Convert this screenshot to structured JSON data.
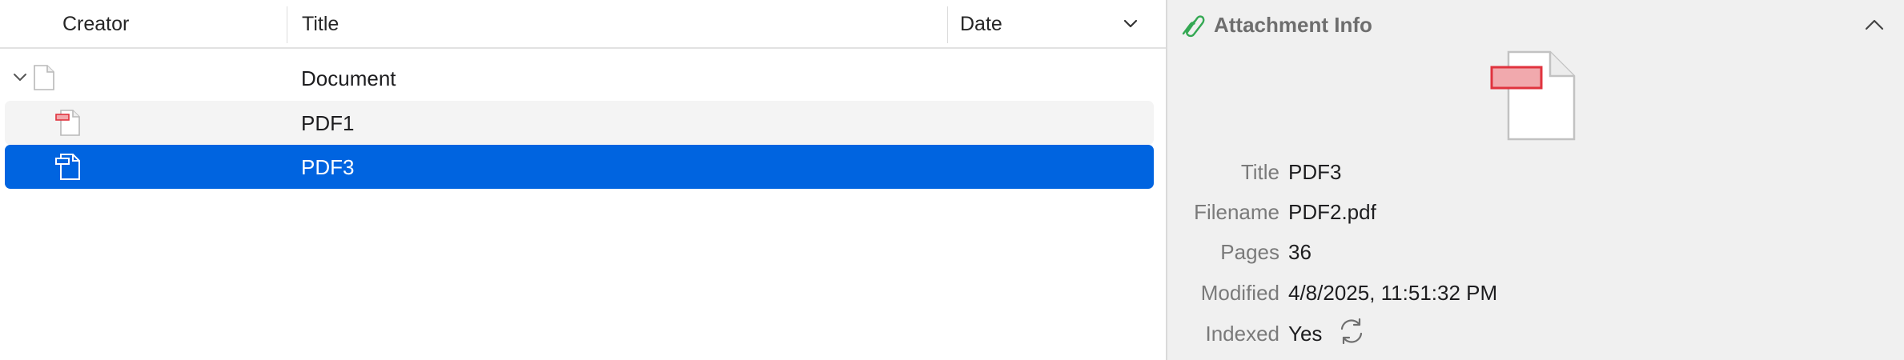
{
  "list": {
    "columns": {
      "creator": "Creator",
      "title": "Title",
      "date": "Date"
    },
    "rows": [
      {
        "title": "Document",
        "icon": "document-icon",
        "expanded": true
      },
      {
        "title": "PDF1",
        "icon": "pdf-attachment-icon"
      },
      {
        "title": "PDF3",
        "icon": "pdf-attachment-icon",
        "selected": true
      }
    ]
  },
  "info": {
    "header": "Attachment Info",
    "fields": {
      "title_label": "Title",
      "title_value": "PDF3",
      "filename_label": "Filename",
      "filename_value": "PDF2.pdf",
      "pages_label": "Pages",
      "pages_value": "36",
      "modified_label": "Modified",
      "modified_value": "4/8/2025, 11:51:32 PM",
      "indexed_label": "Indexed",
      "indexed_value": "Yes"
    }
  },
  "colors": {
    "selection": "#0064e0",
    "pdf_red": "#e0333e",
    "attachment_green": "#34a853",
    "panel_bg": "#f0f0f0"
  }
}
